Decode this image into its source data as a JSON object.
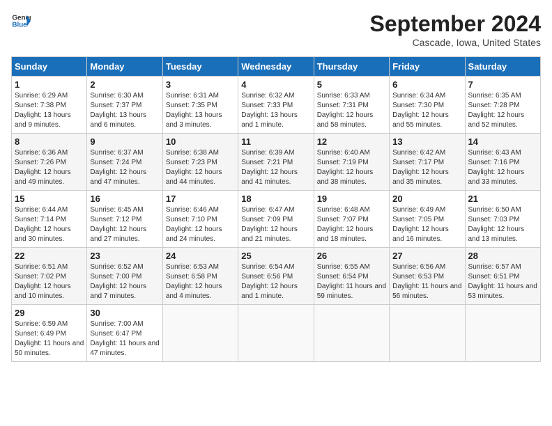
{
  "header": {
    "logo_line1": "General",
    "logo_line2": "Blue",
    "month_title": "September 2024",
    "location": "Cascade, Iowa, United States"
  },
  "weekdays": [
    "Sunday",
    "Monday",
    "Tuesday",
    "Wednesday",
    "Thursday",
    "Friday",
    "Saturday"
  ],
  "weeks": [
    [
      {
        "day": "1",
        "sunrise": "6:29 AM",
        "sunset": "7:38 PM",
        "daylight": "13 hours and 9 minutes."
      },
      {
        "day": "2",
        "sunrise": "6:30 AM",
        "sunset": "7:37 PM",
        "daylight": "13 hours and 6 minutes."
      },
      {
        "day": "3",
        "sunrise": "6:31 AM",
        "sunset": "7:35 PM",
        "daylight": "13 hours and 3 minutes."
      },
      {
        "day": "4",
        "sunrise": "6:32 AM",
        "sunset": "7:33 PM",
        "daylight": "13 hours and 1 minute."
      },
      {
        "day": "5",
        "sunrise": "6:33 AM",
        "sunset": "7:31 PM",
        "daylight": "12 hours and 58 minutes."
      },
      {
        "day": "6",
        "sunrise": "6:34 AM",
        "sunset": "7:30 PM",
        "daylight": "12 hours and 55 minutes."
      },
      {
        "day": "7",
        "sunrise": "6:35 AM",
        "sunset": "7:28 PM",
        "daylight": "12 hours and 52 minutes."
      }
    ],
    [
      {
        "day": "8",
        "sunrise": "6:36 AM",
        "sunset": "7:26 PM",
        "daylight": "12 hours and 49 minutes."
      },
      {
        "day": "9",
        "sunrise": "6:37 AM",
        "sunset": "7:24 PM",
        "daylight": "12 hours and 47 minutes."
      },
      {
        "day": "10",
        "sunrise": "6:38 AM",
        "sunset": "7:23 PM",
        "daylight": "12 hours and 44 minutes."
      },
      {
        "day": "11",
        "sunrise": "6:39 AM",
        "sunset": "7:21 PM",
        "daylight": "12 hours and 41 minutes."
      },
      {
        "day": "12",
        "sunrise": "6:40 AM",
        "sunset": "7:19 PM",
        "daylight": "12 hours and 38 minutes."
      },
      {
        "day": "13",
        "sunrise": "6:42 AM",
        "sunset": "7:17 PM",
        "daylight": "12 hours and 35 minutes."
      },
      {
        "day": "14",
        "sunrise": "6:43 AM",
        "sunset": "7:16 PM",
        "daylight": "12 hours and 33 minutes."
      }
    ],
    [
      {
        "day": "15",
        "sunrise": "6:44 AM",
        "sunset": "7:14 PM",
        "daylight": "12 hours and 30 minutes."
      },
      {
        "day": "16",
        "sunrise": "6:45 AM",
        "sunset": "7:12 PM",
        "daylight": "12 hours and 27 minutes."
      },
      {
        "day": "17",
        "sunrise": "6:46 AM",
        "sunset": "7:10 PM",
        "daylight": "12 hours and 24 minutes."
      },
      {
        "day": "18",
        "sunrise": "6:47 AM",
        "sunset": "7:09 PM",
        "daylight": "12 hours and 21 minutes."
      },
      {
        "day": "19",
        "sunrise": "6:48 AM",
        "sunset": "7:07 PM",
        "daylight": "12 hours and 18 minutes."
      },
      {
        "day": "20",
        "sunrise": "6:49 AM",
        "sunset": "7:05 PM",
        "daylight": "12 hours and 16 minutes."
      },
      {
        "day": "21",
        "sunrise": "6:50 AM",
        "sunset": "7:03 PM",
        "daylight": "12 hours and 13 minutes."
      }
    ],
    [
      {
        "day": "22",
        "sunrise": "6:51 AM",
        "sunset": "7:02 PM",
        "daylight": "12 hours and 10 minutes."
      },
      {
        "day": "23",
        "sunrise": "6:52 AM",
        "sunset": "7:00 PM",
        "daylight": "12 hours and 7 minutes."
      },
      {
        "day": "24",
        "sunrise": "6:53 AM",
        "sunset": "6:58 PM",
        "daylight": "12 hours and 4 minutes."
      },
      {
        "day": "25",
        "sunrise": "6:54 AM",
        "sunset": "6:56 PM",
        "daylight": "12 hours and 1 minute."
      },
      {
        "day": "26",
        "sunrise": "6:55 AM",
        "sunset": "6:54 PM",
        "daylight": "11 hours and 59 minutes."
      },
      {
        "day": "27",
        "sunrise": "6:56 AM",
        "sunset": "6:53 PM",
        "daylight": "11 hours and 56 minutes."
      },
      {
        "day": "28",
        "sunrise": "6:57 AM",
        "sunset": "6:51 PM",
        "daylight": "11 hours and 53 minutes."
      }
    ],
    [
      {
        "day": "29",
        "sunrise": "6:59 AM",
        "sunset": "6:49 PM",
        "daylight": "11 hours and 50 minutes."
      },
      {
        "day": "30",
        "sunrise": "7:00 AM",
        "sunset": "6:47 PM",
        "daylight": "11 hours and 47 minutes."
      },
      null,
      null,
      null,
      null,
      null
    ]
  ],
  "labels": {
    "sunrise_prefix": "Sunrise: ",
    "sunset_prefix": "Sunset: ",
    "daylight_prefix": "Daylight: "
  }
}
